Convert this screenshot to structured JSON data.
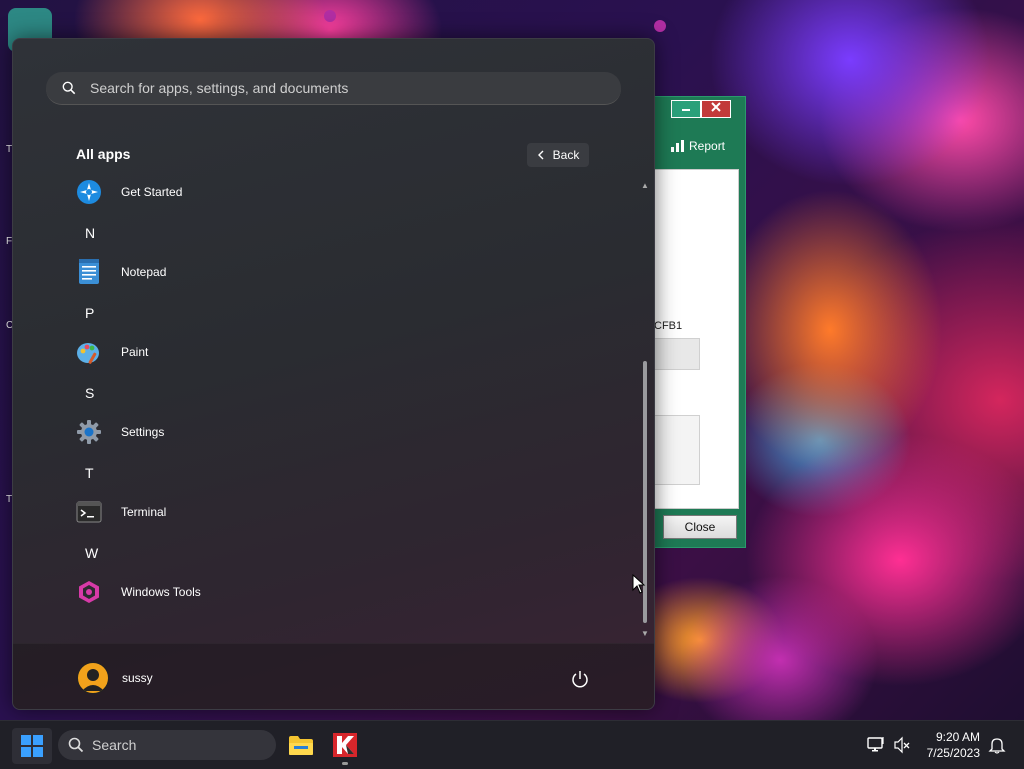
{
  "start_menu": {
    "search_placeholder": "Search for apps, settings, and documents",
    "section_title": "All apps",
    "back_label": "Back",
    "items": [
      {
        "type": "app",
        "label": "Get Started",
        "icon": "get-started-icon"
      },
      {
        "type": "letter",
        "label": "N"
      },
      {
        "type": "app",
        "label": "Notepad",
        "icon": "notepad-icon"
      },
      {
        "type": "letter",
        "label": "P"
      },
      {
        "type": "app",
        "label": "Paint",
        "icon": "paint-icon"
      },
      {
        "type": "letter",
        "label": "S"
      },
      {
        "type": "app",
        "label": "Settings",
        "icon": "settings-icon"
      },
      {
        "type": "letter",
        "label": "T"
      },
      {
        "type": "app",
        "label": "Terminal",
        "icon": "terminal-icon"
      },
      {
        "type": "letter",
        "label": "W"
      },
      {
        "type": "app",
        "label": "Windows Tools",
        "icon": "windows-tools-icon"
      }
    ],
    "user_name": "sussy"
  },
  "background_window": {
    "report_label": "Report",
    "partial_text": "CFB1",
    "close_label": "Close"
  },
  "taskbar": {
    "search_label": "Search",
    "time": "9:20 AM",
    "date": "7/25/2023"
  },
  "colors": {
    "accent": "#3aa0ff",
    "window_green": "#1e7a55",
    "start_bg": "#2c2e33"
  }
}
